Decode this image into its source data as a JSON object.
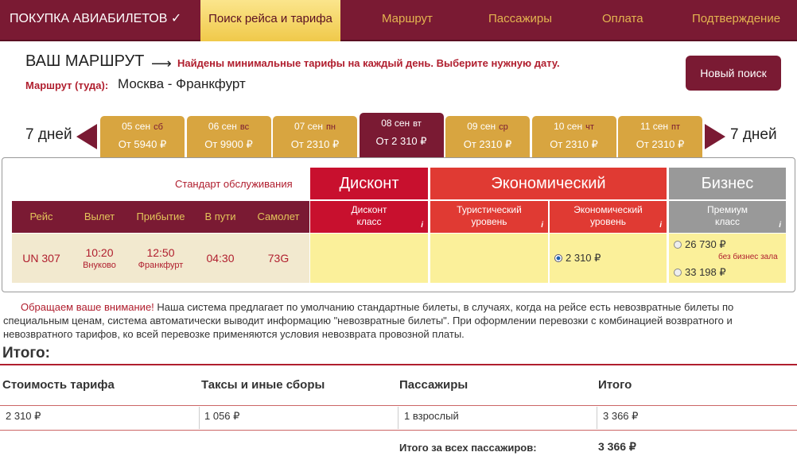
{
  "nav": {
    "brand": "ПОКУПКА АВИАБИЛЕТОВ ✓",
    "active": "Поиск рейса и тарифа",
    "items": [
      "Маршрут",
      "Пассажиры",
      "Оплата",
      "Подтверждение"
    ]
  },
  "route": {
    "title": "ВАШ МАРШРУТ",
    "note": "Найдены минимальные тарифы на каждый день. Выберите нужную дату.",
    "label": "Маршрут (туда):",
    "value": "Москва - Франкфурт",
    "new_search": "Новый поиск"
  },
  "days": {
    "prev_label": "7 дней",
    "next_label": "7 дней",
    "tabs": [
      {
        "date": "05 сен",
        "dow": "сб",
        "price": "От 5940 ₽",
        "selected": false
      },
      {
        "date": "06 сен",
        "dow": "вс",
        "price": "От 9900 ₽",
        "selected": false
      },
      {
        "date": "07 сен",
        "dow": "пн",
        "price": "От 2310 ₽",
        "selected": false
      },
      {
        "date": "08 сен",
        "dow": "вт",
        "price": "От 2 310 ₽",
        "selected": true
      },
      {
        "date": "09 сен",
        "dow": "ср",
        "price": "От 2310 ₽",
        "selected": false
      },
      {
        "date": "10 сен",
        "dow": "чт",
        "price": "От 2310 ₽",
        "selected": false
      },
      {
        "date": "11 сен",
        "dow": "пт",
        "price": "От 2310 ₽",
        "selected": false
      }
    ]
  },
  "fares": {
    "standard_label": "Стандарт обслуживания",
    "families": {
      "discount": "Дисконт",
      "economy": "Экономический",
      "business": "Бизнес"
    },
    "subclasses": {
      "discount": "Дисконт класс",
      "tourist": "Туристический уровень",
      "economy": "Экономический уровень",
      "premium": "Премиум класс"
    },
    "info_glyph": "i",
    "columns": {
      "flight": "Рейс",
      "departure": "Вылет",
      "arrival": "Прибытие",
      "duration": "В пути",
      "aircraft": "Самолет"
    },
    "row": {
      "flight": "UN 307",
      "dep_time": "10:20",
      "dep_airport": "Внуково",
      "arr_time": "12:50",
      "arr_airport": "Франкфурт",
      "duration": "04:30",
      "aircraft": "73G",
      "economy_price": "2 310 ₽",
      "business_price_1": "26 730 ₽",
      "business_note_1": "без бизнес зала",
      "business_price_2": "33 198 ₽"
    }
  },
  "notice": {
    "highlight": "Обращаем ваше внимание!",
    "text": " Наша система предлагает по умолчанию стандартные билеты, в случаях, когда на рейсе есть невозвратные билеты по специальным ценам, система автоматически выводит информацию \"невозвратные билеты\". При оформлении перевозки с комбинацией возвратного и невозвратного тарифов, ко всей перевозке применяются условия невозврата провозной платы."
  },
  "totals": {
    "title": "Итого:",
    "headers": {
      "fare": "Стоимость тарифа",
      "taxes": "Таксы и иные сборы",
      "passengers": "Пассажиры",
      "total": "Итого"
    },
    "values": {
      "fare": "2 310 ₽",
      "taxes": "1 056 ₽",
      "passengers": "1 взрослый",
      "total": "3 366 ₽"
    },
    "grand_label": "Итого за всех пассажиров:",
    "grand_value": "3 366 ₽"
  },
  "colors": {
    "brand": "#7a1a33",
    "accent_gold": "#d8a540",
    "discount_red": "#c8102e",
    "economy_red": "#e03a33",
    "business_gray": "#999999"
  }
}
